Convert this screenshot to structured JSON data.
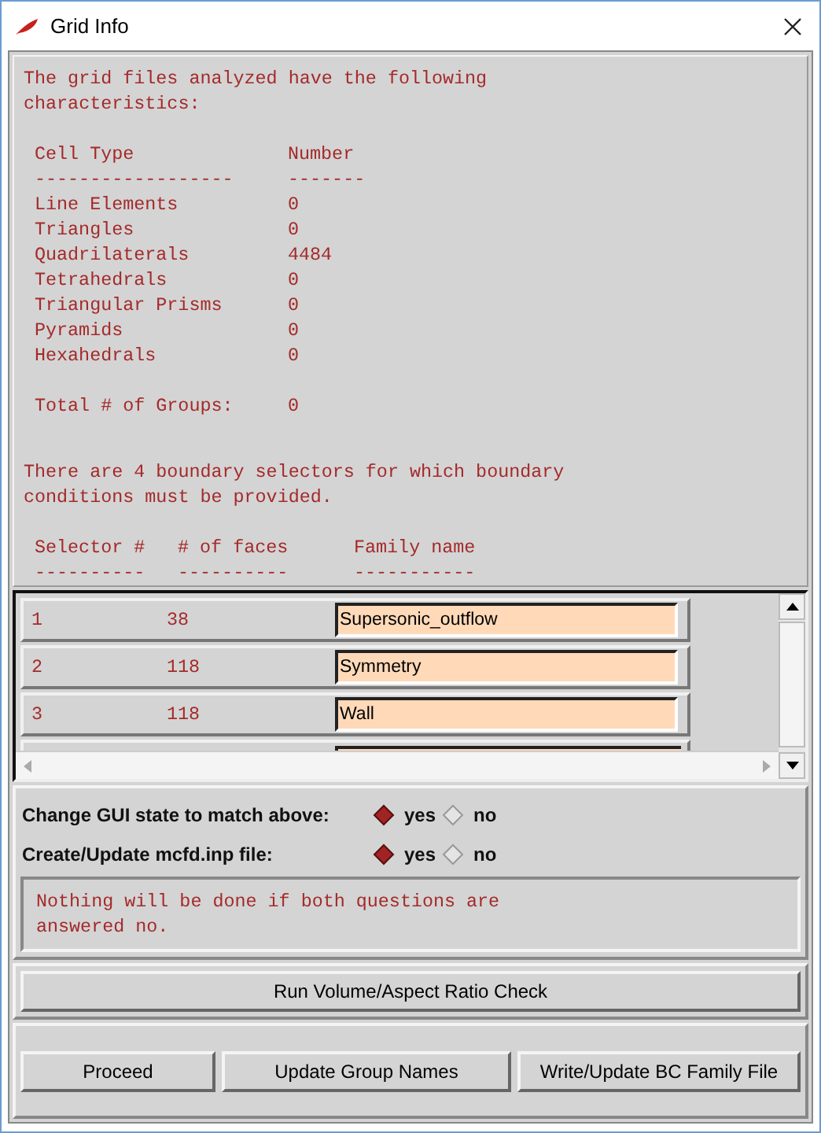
{
  "window": {
    "title": "Grid Info"
  },
  "intro": "The grid files analyzed have the following characteristics:",
  "cell_table": {
    "columns": [
      "Cell Type",
      "Number"
    ],
    "rules": [
      "------------------",
      "-------"
    ],
    "rows": [
      {
        "type": "Line Elements",
        "number": "0"
      },
      {
        "type": "Triangles",
        "number": "0"
      },
      {
        "type": "Quadrilaterals",
        "number": "4484"
      },
      {
        "type": "Tetrahedrals",
        "number": "0"
      },
      {
        "type": "Triangular Prisms",
        "number": "0"
      },
      {
        "type": "Pyramids",
        "number": "0"
      },
      {
        "type": "Hexahedrals",
        "number": "0"
      }
    ]
  },
  "total": {
    "label": "Total # of Groups:",
    "value": "0"
  },
  "boundary_note": "There are 4 boundary selectors for which boundary conditions must be provided.",
  "selector_table": {
    "columns": [
      "Selector #",
      "# of faces",
      "Family name"
    ],
    "rules": [
      "----------",
      "----------",
      "-----------"
    ],
    "rows": [
      {
        "selector": "1",
        "faces": "38",
        "family": "Supersonic_outflow"
      },
      {
        "selector": "2",
        "faces": "118",
        "family": "Symmetry"
      },
      {
        "selector": "3",
        "faces": "118",
        "family": "Wall"
      }
    ]
  },
  "questions": [
    {
      "label": "Change GUI state to match above:",
      "options": [
        {
          "label": "yes",
          "selected": true
        },
        {
          "label": "no",
          "selected": false
        }
      ]
    },
    {
      "label": "Create/Update mcfd.inp file:",
      "options": [
        {
          "label": "yes",
          "selected": true
        },
        {
          "label": "no",
          "selected": false
        }
      ]
    }
  ],
  "warning": "Nothing will be done if both questions are answered no.",
  "check_button": "Run Volume/Aspect Ratio Check",
  "buttons": [
    "Proceed",
    "Update Group Names",
    "Write/Update BC Family File"
  ]
}
